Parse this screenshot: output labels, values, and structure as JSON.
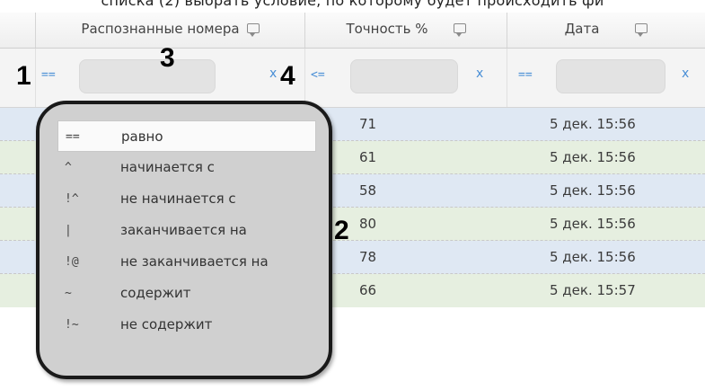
{
  "caption": "списка (2) выбрать условие, по которому будет происходить фи",
  "columns": {
    "plates": "Распознанные номера",
    "accuracy": "Точность %",
    "date": "Дата"
  },
  "filters": {
    "plates_op": "==",
    "plates_clear": "x",
    "accuracy_op": "<=",
    "accuracy_clear": "x",
    "date_op": "==",
    "date_clear": "x"
  },
  "rows": [
    {
      "accuracy": "71",
      "date": "5 дек. 15:56"
    },
    {
      "accuracy": "61",
      "date": "5 дек. 15:56"
    },
    {
      "accuracy": "58",
      "date": "5 дек. 15:56"
    },
    {
      "accuracy": "80",
      "date": "5 дек. 15:56"
    },
    {
      "accuracy": "78",
      "date": "5 дек. 15:56"
    },
    {
      "accuracy": "66",
      "date": "5 дек. 15:57"
    }
  ],
  "condition_menu": [
    {
      "symbol": "==",
      "label": "равно"
    },
    {
      "symbol": "^",
      "label": "начинается с"
    },
    {
      "symbol": "!^",
      "label": "не начинается с"
    },
    {
      "symbol": "|",
      "label": "заканчивается на"
    },
    {
      "symbol": "!@",
      "label": "не заканчивается на"
    },
    {
      "symbol": "~",
      "label": "содержит"
    },
    {
      "symbol": "!~",
      "label": "не содержит"
    }
  ],
  "callouts": {
    "one": "1",
    "two": "2",
    "three": "3",
    "four": "4"
  },
  "colors": {
    "accent": "#4a8fd6",
    "row_blue": "#dfe8f3",
    "row_green": "#e6efe0"
  }
}
